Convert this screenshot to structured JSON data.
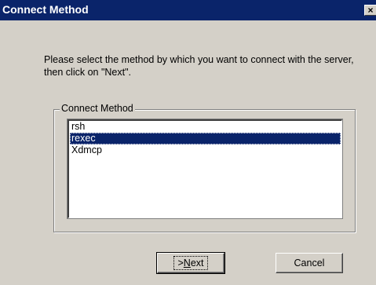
{
  "window": {
    "title": "Connect Method",
    "close_glyph": "×"
  },
  "instructions": "Please select the method by which you want to connect with the server, then click on \"Next\".",
  "group": {
    "label": "Connect Method",
    "items": [
      "rsh",
      "rexec",
      "Xdmcp"
    ],
    "selected_index": 1
  },
  "buttons": {
    "next_prefix": ">",
    "next_mnemonic": "N",
    "next_rest": "ext",
    "cancel_label": "Cancel"
  },
  "colors": {
    "titlebar": "#0a246a",
    "dialog_bg": "#d4d0c8",
    "selection": "#0a246a"
  }
}
